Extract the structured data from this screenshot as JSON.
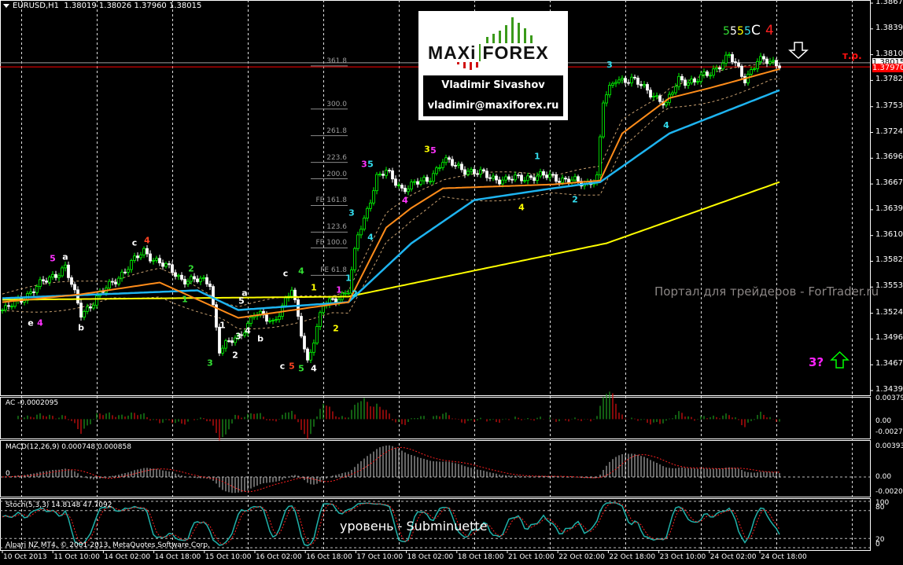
{
  "header": {
    "symbol": "EURUSD,H1",
    "ohlc": "1.38019 1.38026 1.37960 1.38015"
  },
  "price_axis": {
    "labels": [
      "1.38675",
      "1.38390",
      "1.38105",
      "1.37820",
      "1.37530",
      "1.37245",
      "1.36960",
      "1.36675",
      "1.36390",
      "1.36105",
      "1.35820",
      "1.35535",
      "1.35245",
      "1.34960",
      "1.34675",
      "1.34390"
    ],
    "bid_label": "1.38015",
    "red_label": "1.37970",
    "bid_price": 1.38015,
    "red_price": 1.3797,
    "min": 1.3439,
    "max": 1.38675
  },
  "time_axis": [
    "10 Oct 2013",
    "11 Oct 10:00",
    "14 Oct 02:00",
    "14 Oct 18:00",
    "15 Oct 10:00",
    "16 Oct 02:00",
    "16 Oct 18:00",
    "17 Oct 10:00",
    "18 Oct 02:00",
    "18 Oct 18:00",
    "21 Oct 10:00",
    "22 Oct 02:00",
    "22 Oct 18:00",
    "23 Oct 10:00",
    "24 Oct 02:00",
    "24 Oct 18:00"
  ],
  "logo": {
    "brand_left": "MAXi",
    "brand_right": "FOREX",
    "name": "Vladimir Sivashov",
    "email": "vladimir@maxiforex.ru",
    "colors": {
      "green": "#3a9a1a",
      "red": "#d01010"
    }
  },
  "annotations": {
    "tp": "т.р.",
    "question": "3?",
    "watermark": "Портал для трейдеров - ForTrader.ru",
    "level_caption": "уровень - Subminuette",
    "copyright": "Alpari NZ MT4, © 2001-2013, MetaQuotes Software Corp."
  },
  "fib_levels": [
    {
      "label": "361.8",
      "price": 1.37981
    },
    {
      "label": "300.0",
      "price": 1.37504
    },
    {
      "label": "261.8",
      "price": 1.37209
    },
    {
      "label": "223.6",
      "price": 1.36914
    },
    {
      "label": "200.0",
      "price": 1.36732
    },
    {
      "label": "FE 161.8",
      "price": 1.36437
    },
    {
      "label": "123.6",
      "price": 1.36142
    },
    {
      "label": "FE 100.0",
      "price": 1.35968
    },
    {
      "label": "FE 61.8",
      "price": 1.35664
    }
  ],
  "indicators": {
    "ac": {
      "label": "AC -0.0002095",
      "axis": [
        "0.003795",
        "0.00",
        "-0.002717"
      ]
    },
    "macd": {
      "label": "MACD(12,26,9) 0.000748 0.000858",
      "zero": "0",
      "axis": [
        "0.003938",
        "0.00",
        "-0.002095"
      ]
    },
    "stoch": {
      "label": "Stoch(5,3,3) 14.8148 47.7092",
      "axis": [
        "100",
        "80",
        "20",
        "0"
      ]
    }
  },
  "chart_data": {
    "type": "candlestick",
    "bars": 248,
    "close_path": [
      [
        1,
        1.35281
      ],
      [
        20,
        1.35759
      ],
      [
        25,
        1.35238
      ],
      [
        45,
        1.35932
      ],
      [
        57,
        1.35628
      ],
      [
        66,
        1.35585
      ],
      [
        69,
        1.34847
      ],
      [
        75,
        1.34977
      ],
      [
        80,
        1.35238
      ],
      [
        86,
        1.35151
      ],
      [
        92,
        1.35498
      ],
      [
        97,
        1.34717
      ],
      [
        102,
        1.35325
      ],
      [
        110,
        1.35498
      ],
      [
        113,
        1.36106
      ],
      [
        115,
        1.3628
      ],
      [
        119,
        1.36757
      ],
      [
        122,
        1.368
      ],
      [
        127,
        1.36627
      ],
      [
        135,
        1.36714
      ],
      [
        140,
        1.36931
      ],
      [
        150,
        1.368
      ],
      [
        160,
        1.36714
      ],
      [
        167,
        1.36757
      ],
      [
        175,
        1.36757
      ],
      [
        185,
        1.3667
      ],
      [
        189,
        1.36757
      ],
      [
        191,
        1.37582
      ],
      [
        195,
        1.37842
      ],
      [
        200,
        1.37825
      ],
      [
        207,
        1.37669
      ],
      [
        211,
        1.37538
      ],
      [
        215,
        1.37842
      ],
      [
        220,
        1.37799
      ],
      [
        225,
        1.37911
      ],
      [
        231,
        1.38085
      ],
      [
        236,
        1.37842
      ],
      [
        240,
        1.38033
      ],
      [
        246,
        1.38015
      ]
    ],
    "ma_yellow": [
      [
        0,
        1.35394
      ],
      [
        110,
        1.35429
      ],
      [
        192,
        1.36019
      ],
      [
        247,
        1.36696
      ]
    ],
    "ma_blue": [
      [
        0,
        1.35411
      ],
      [
        62,
        1.35498
      ],
      [
        75,
        1.35281
      ],
      [
        110,
        1.35368
      ],
      [
        130,
        1.36019
      ],
      [
        150,
        1.36497
      ],
      [
        175,
        1.36627
      ],
      [
        190,
        1.36696
      ],
      [
        212,
        1.37234
      ],
      [
        247,
        1.37712
      ]
    ],
    "ma_orange": [
      [
        0,
        1.35368
      ],
      [
        25,
        1.35455
      ],
      [
        50,
        1.35585
      ],
      [
        75,
        1.35194
      ],
      [
        110,
        1.35368
      ],
      [
        122,
        1.36193
      ],
      [
        130,
        1.3641
      ],
      [
        140,
        1.36627
      ],
      [
        175,
        1.3667
      ],
      [
        190,
        1.36713
      ],
      [
        197,
        1.37234
      ],
      [
        212,
        1.37625
      ],
      [
        225,
        1.37738
      ],
      [
        247,
        1.37946
      ]
    ],
    "wave_labels": [
      {
        "t": "e",
        "c": "#ffffff",
        "bar": 9,
        "p": 1.35108
      },
      {
        "t": "4",
        "c": "#ff33ff",
        "bar": 12,
        "p": 1.35108
      },
      {
        "t": "5",
        "c": "#ff33ff",
        "bar": 16,
        "p": 1.35819
      },
      {
        "t": "a",
        "c": "#ffffff",
        "bar": 20,
        "p": 1.35837
      },
      {
        "t": "b",
        "c": "#ffffff",
        "bar": 25,
        "p": 1.35055
      },
      {
        "t": "c",
        "c": "#ffffff",
        "bar": 42,
        "p": 1.35993
      },
      {
        "t": "4",
        "c": "#ff4422",
        "bar": 46,
        "p": 1.36019
      },
      {
        "t": "1",
        "c": "#33dd33",
        "bar": 58,
        "p": 1.35368
      },
      {
        "t": "2",
        "c": "#33dd33",
        "bar": 60,
        "p": 1.35706
      },
      {
        "t": "3",
        "c": "#33dd33",
        "bar": 66,
        "p": 1.34665
      },
      {
        "t": "1",
        "c": "#ffffff",
        "bar": 70,
        "p": 1.35081
      },
      {
        "t": "2",
        "c": "#ffffff",
        "bar": 74,
        "p": 1.34752
      },
      {
        "t": "3",
        "c": "#ffffff",
        "bar": 75,
        "p": 1.3496
      },
      {
        "t": "4",
        "c": "#ffffff",
        "bar": 78,
        "p": 1.35021
      },
      {
        "t": "5",
        "c": "#ffffff",
        "bar": 76,
        "p": 1.35351
      },
      {
        "t": "a",
        "c": "#ffffff",
        "bar": 77,
        "p": 1.35437
      },
      {
        "t": "b",
        "c": "#ffffff",
        "bar": 82,
        "p": 1.34934
      },
      {
        "t": "c",
        "c": "#ffffff",
        "bar": 90,
        "p": 1.35654
      },
      {
        "t": "4",
        "c": "#33dd33",
        "bar": 95,
        "p": 1.3568
      },
      {
        "t": "c",
        "c": "#ffffff",
        "bar": 89,
        "p": 1.3463
      },
      {
        "t": "5",
        "c": "#ff4422",
        "bar": 92,
        "p": 1.3463
      },
      {
        "t": "5",
        "c": "#33dd33",
        "bar": 95,
        "p": 1.34604
      },
      {
        "t": "4",
        "c": "#ffffff",
        "bar": 99,
        "p": 1.34604
      },
      {
        "t": "1",
        "c": "#ffff00",
        "bar": 99,
        "p": 1.35498
      },
      {
        "t": "2",
        "c": "#ffff00",
        "bar": 106,
        "p": 1.35047
      },
      {
        "t": "1",
        "c": "#ff33ff",
        "bar": 107,
        "p": 1.35472
      },
      {
        "t": "1",
        "c": "#33ddee",
        "bar": 110,
        "p": 1.35602
      },
      {
        "t": "2",
        "c": "#33ddee",
        "bar": 112,
        "p": 1.35428
      },
      {
        "t": "3",
        "c": "#33ddee",
        "bar": 111,
        "p": 1.36323
      },
      {
        "t": "4",
        "c": "#33ddee",
        "bar": 117,
        "p": 1.36054
      },
      {
        "t": "3",
        "c": "#ff33ff",
        "bar": 115,
        "p": 1.36861
      },
      {
        "t": "5",
        "c": "#33ddee",
        "bar": 117,
        "p": 1.36861
      },
      {
        "t": "4",
        "c": "#ff33ff",
        "bar": 128,
        "p": 1.36462
      },
      {
        "t": "3",
        "c": "#ffff00",
        "bar": 135,
        "p": 1.37026
      },
      {
        "t": "5",
        "c": "#ff33ff",
        "bar": 137,
        "p": 1.37017
      },
      {
        "t": "4",
        "c": "#ffff00",
        "bar": 165,
        "p": 1.36383
      },
      {
        "t": "1",
        "c": "#33ddee",
        "bar": 170,
        "p": 1.36948
      },
      {
        "t": "2",
        "c": "#33ddee",
        "bar": 182,
        "p": 1.3647
      },
      {
        "t": "3",
        "c": "#33ddee",
        "bar": 193,
        "p": 1.37963
      },
      {
        "t": "4",
        "c": "#33ddee",
        "bar": 211,
        "p": 1.37295
      }
    ],
    "top_labels": [
      {
        "t": "5",
        "c": "#33dd33"
      },
      {
        "t": "5",
        "c": "#ffffff"
      },
      {
        "t": "5",
        "c": "#ffff00"
      },
      {
        "t": "5",
        "c": "#33ddee"
      },
      {
        "t": "C",
        "c": "#ffffff"
      },
      {
        "t": "4",
        "c": "#ff2020"
      }
    ]
  }
}
